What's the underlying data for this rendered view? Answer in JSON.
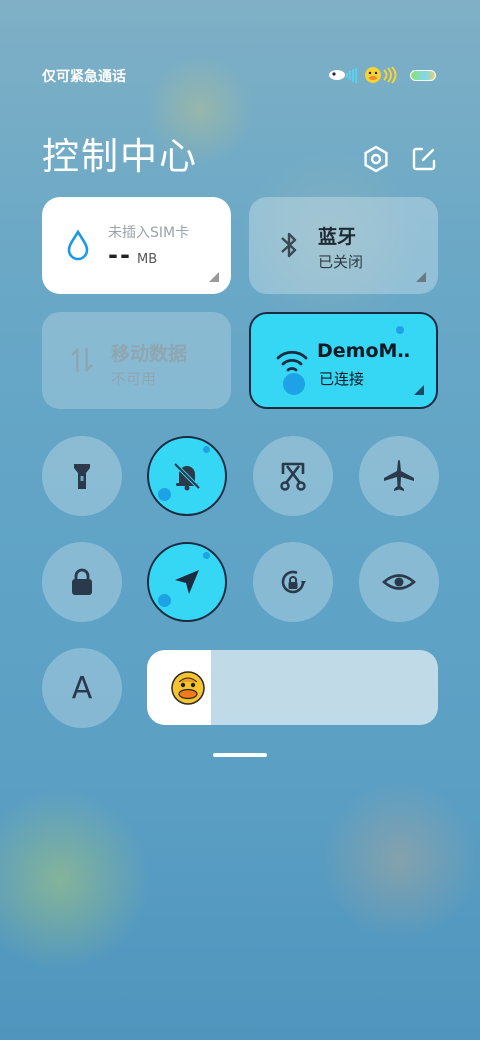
{
  "status_bar": {
    "carrier_text": "仅可紧急通话"
  },
  "header": {
    "title": "控制中心",
    "settings_icon": "settings-hex-icon",
    "edit_icon": "edit-icon"
  },
  "tiles": {
    "data": {
      "label": "未插入SIM卡",
      "value": "--",
      "unit": "MB",
      "icon": "water-drop-icon"
    },
    "bluetooth": {
      "label": "蓝牙",
      "status": "已关闭",
      "icon": "bluetooth-icon"
    },
    "mobile_data": {
      "label": "移动数据",
      "status": "不可用",
      "icon": "data-arrows-icon"
    },
    "wifi": {
      "label": "DemoM‥",
      "status": "已连接",
      "icon": "wifi-icon"
    }
  },
  "toggles": [
    {
      "name": "flashlight",
      "icon": "flashlight-icon",
      "active": false
    },
    {
      "name": "silent",
      "icon": "bell-off-icon",
      "active": true
    },
    {
      "name": "screenshot",
      "icon": "scissors-icon",
      "active": false
    },
    {
      "name": "airplane",
      "icon": "airplane-icon",
      "active": false
    },
    {
      "name": "lock",
      "icon": "lock-icon",
      "active": false
    },
    {
      "name": "location",
      "icon": "location-arrow-icon",
      "active": true
    },
    {
      "name": "rotation-lock",
      "icon": "rotation-lock-icon",
      "active": false
    },
    {
      "name": "eye-care",
      "icon": "eye-icon",
      "active": false
    }
  ],
  "font_button": {
    "label": "A"
  },
  "brightness": {
    "level": 0.22,
    "icon": "duck-icon"
  },
  "colors": {
    "accent": "#36d7f5",
    "accent_border": "#1b2b40",
    "bubble": "#1da2e6",
    "icon_dark": "#2a3a4a"
  }
}
